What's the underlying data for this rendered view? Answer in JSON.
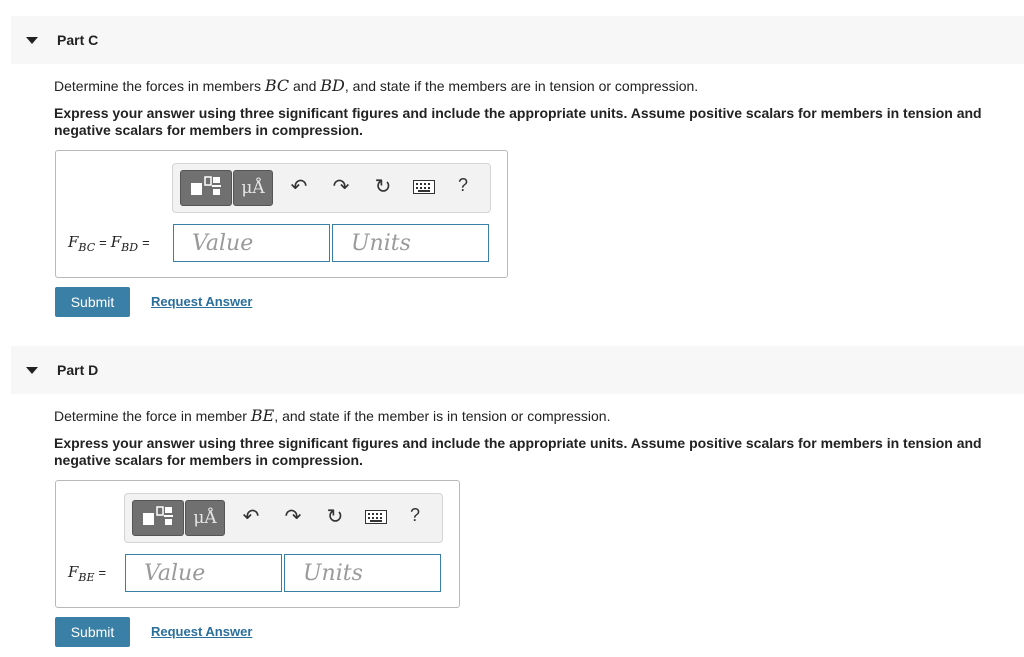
{
  "parts": [
    {
      "title": "Part C",
      "prompt_pre": "Determine the forces in members ",
      "var1": "BC",
      "mid": " and ",
      "var2": "BD",
      "prompt_post": ", and state if the members are in tension or compression.",
      "instruction": "Express your answer using three significant figures and include the appropriate units. Assume positive scalars for members in tension and negative scalars for members in compression.",
      "lhs": {
        "f1": "F",
        "s1": "BC",
        "f2": "F",
        "s2": "BD",
        "eq": "="
      },
      "value_placeholder": "Value",
      "units_placeholder": "Units",
      "submit_label": "Submit",
      "request_label": "Request Answer"
    },
    {
      "title": "Part D",
      "prompt_pre": "Determine the force in member ",
      "var1": "BE",
      "prompt_post": ", and state if the member is in tension or compression.",
      "instruction": "Express your answer using three significant figures and include the appropriate units. Assume positive scalars for members in tension and negative scalars for members in compression.",
      "lhs": {
        "f1": "F",
        "s1": "BE",
        "eq": "="
      },
      "value_placeholder": "Value",
      "units_placeholder": "Units",
      "submit_label": "Submit",
      "request_label": "Request Answer"
    }
  ],
  "toolbar": {
    "units_symbol": "μÅ",
    "help": "?",
    "icons": [
      "templates-icon",
      "units-icon",
      "undo-icon",
      "redo-icon",
      "reset-icon",
      "keyboard-icon",
      "help-icon"
    ]
  }
}
